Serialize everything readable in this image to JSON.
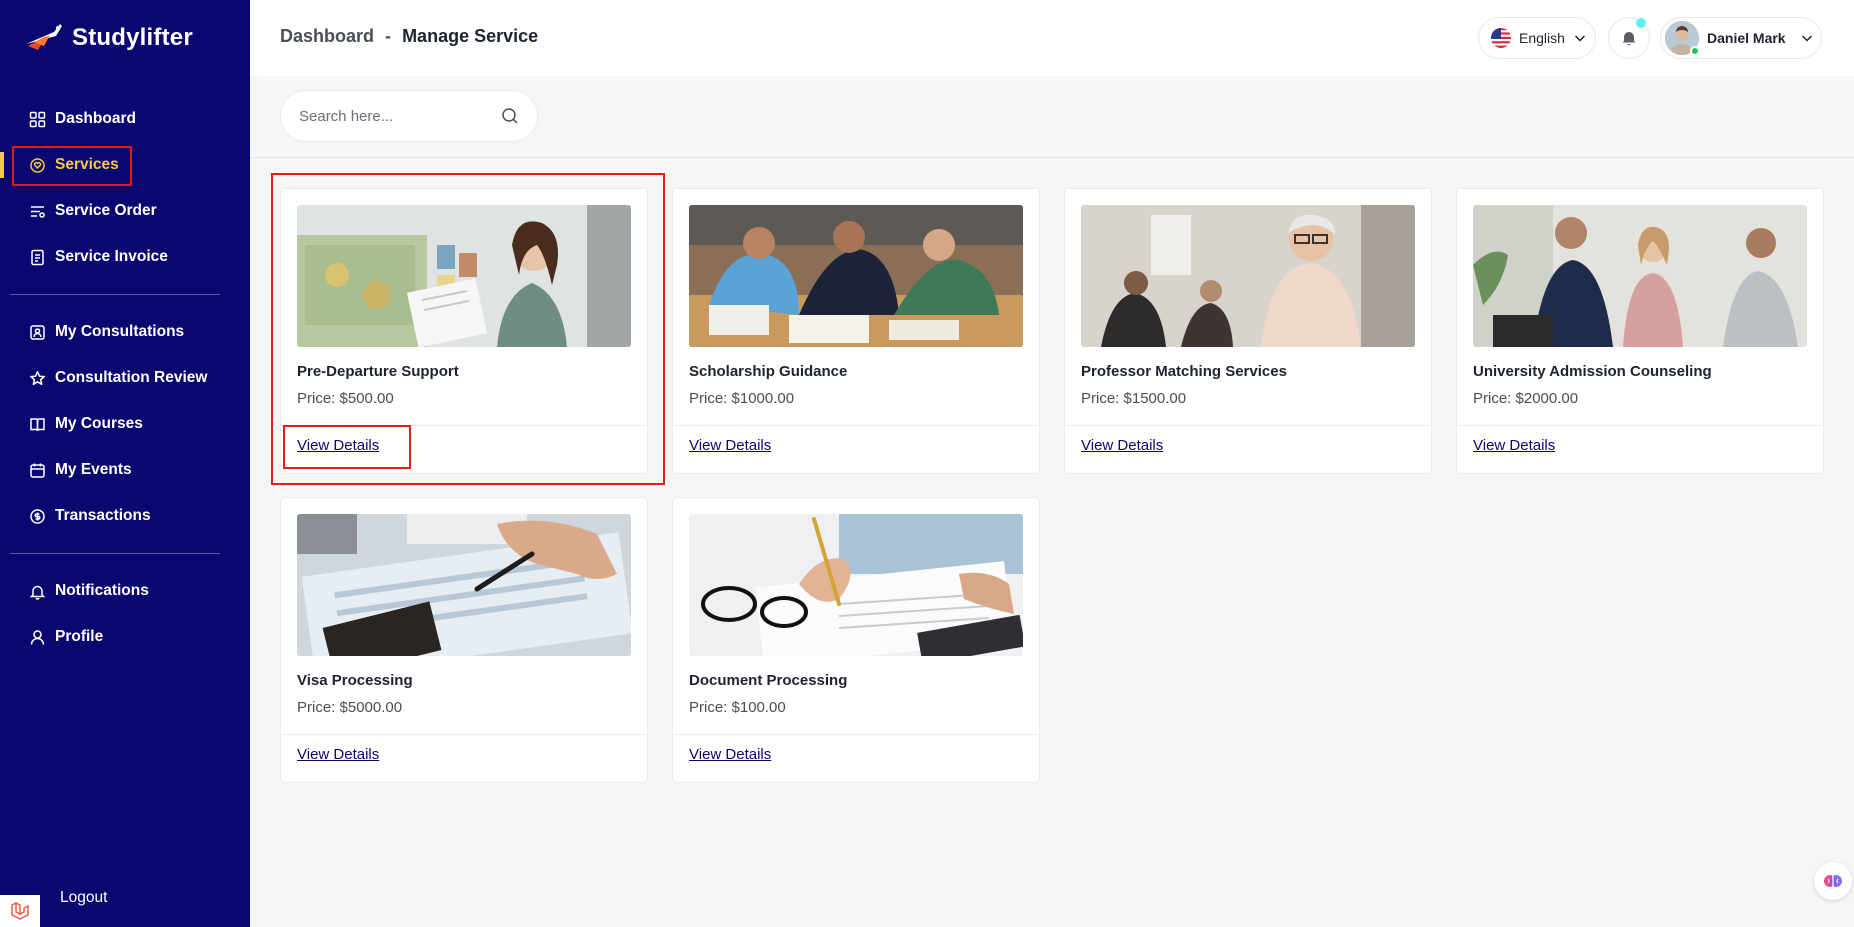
{
  "brand": {
    "name": "Studylifter"
  },
  "sidebar": {
    "group1": [
      {
        "label": "Dashboard",
        "icon": "grid-icon"
      },
      {
        "label": "Services",
        "icon": "heart-hand-icon",
        "active": true
      },
      {
        "label": "Service Order",
        "icon": "sliders-icon"
      },
      {
        "label": "Service Invoice",
        "icon": "invoice-icon"
      }
    ],
    "group2": [
      {
        "label": "My Consultations",
        "icon": "consult-icon"
      },
      {
        "label": "Consultation Review",
        "icon": "star-icon"
      },
      {
        "label": "My Courses",
        "icon": "book-icon"
      },
      {
        "label": "My Events",
        "icon": "calendar-icon"
      },
      {
        "label": "Transactions",
        "icon": "coin-icon"
      }
    ],
    "group3": [
      {
        "label": "Notifications",
        "icon": "bell-icon"
      },
      {
        "label": "Profile",
        "icon": "user-icon"
      }
    ],
    "logout_label": "Logout"
  },
  "header": {
    "breadcrumb_root": "Dashboard",
    "breadcrumb_sep": "-",
    "breadcrumb_current": "Manage Service",
    "language": "English",
    "user_name": "Daniel Mark"
  },
  "search": {
    "placeholder": "Search here..."
  },
  "services": [
    {
      "title": "Pre-Departure Support",
      "price": "Price: $500.00",
      "link": "View Details"
    },
    {
      "title": "Scholarship Guidance",
      "price": "Price: $1000.00",
      "link": "View Details"
    },
    {
      "title": "Professor Matching Services",
      "price": "Price: $1500.00",
      "link": "View Details"
    },
    {
      "title": "University Admission Counseling",
      "price": "Price: $2000.00",
      "link": "View Details"
    },
    {
      "title": "Visa Processing",
      "price": "Price: $5000.00",
      "link": "View Details"
    },
    {
      "title": "Document Processing",
      "price": "Price: $100.00",
      "link": "View Details"
    }
  ],
  "colors": {
    "sidebar_bg": "#0a0770",
    "active": "#f7c948",
    "highlight": "#e21b1b",
    "notification_dot": "#5ef0f0"
  }
}
